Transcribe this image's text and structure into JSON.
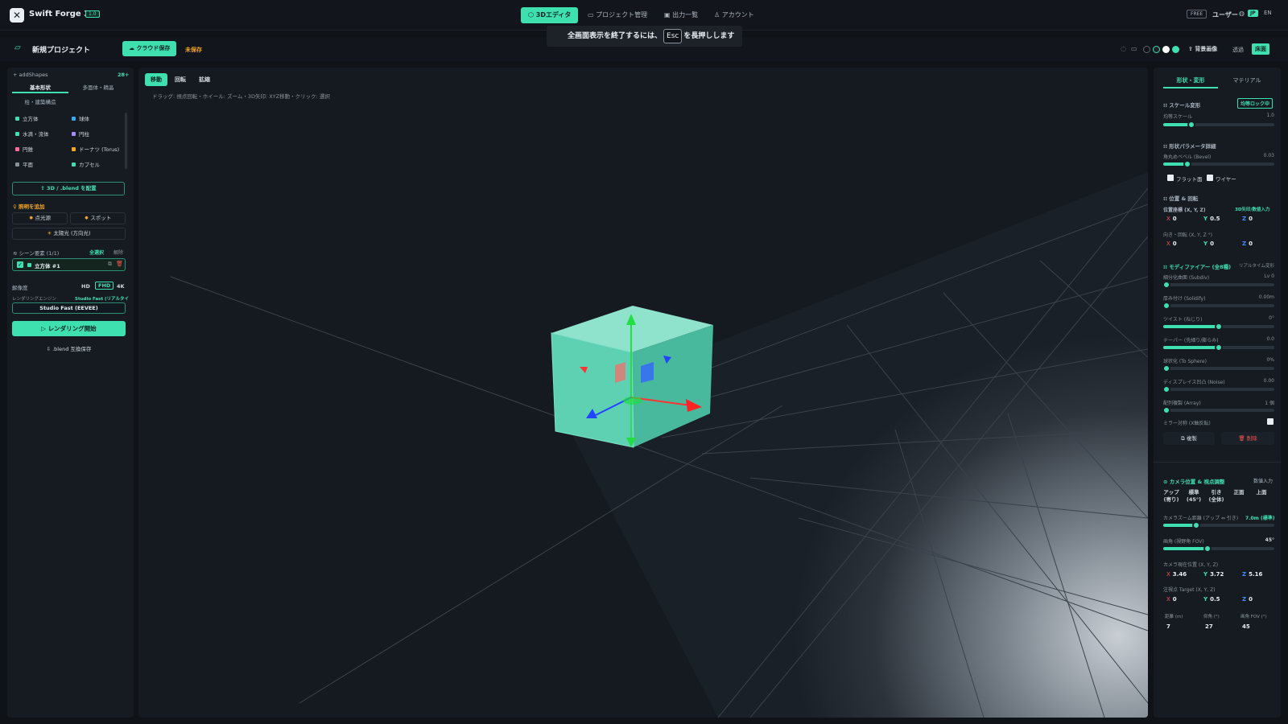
{
  "app": {
    "logo_icon": "app-logo-icon",
    "title": "Swift Forge 3D",
    "version": "1.0"
  },
  "nav": {
    "tabs": [
      {
        "label": "3Dエディタ",
        "icon": "cube-icon",
        "active": true
      },
      {
        "label": "プロジェクト管理",
        "icon": "folder-icon"
      },
      {
        "label": "出力一覧",
        "icon": "image-icon"
      },
      {
        "label": "アカウント",
        "icon": "user-icon"
      }
    ]
  },
  "top_right": {
    "plan": "FREE",
    "user": "ユーザー",
    "lang_jp": "JP",
    "lang_en": "EN"
  },
  "toast": {
    "prefix": "全画面表示を終了するには、",
    "key": "Esc",
    "suffix": "を長押しします"
  },
  "project": {
    "name": "新規プロジェクト",
    "cloud_save": "クラウド保存",
    "status": "未保存"
  },
  "toolbar": {
    "swatches": [
      "#0f1318",
      "#1c232b",
      "#ffffff",
      "#3ee0b0"
    ],
    "bg_image": "背景画像",
    "transparent": "透過",
    "floor": "床面"
  },
  "left": {
    "add_shapes": "addShapes",
    "count": "28+",
    "tabs": [
      "基本形状",
      "多面体・精晶",
      "柱・建築構造"
    ],
    "shapes": [
      {
        "label": "立方体",
        "color": "#3ee0b0"
      },
      {
        "label": "球体",
        "color": "#3aa8ff"
      },
      {
        "label": "水滴・流体",
        "color": "#3ee0b0"
      },
      {
        "label": "円柱",
        "color": "#a78bfa"
      },
      {
        "label": "円錐",
        "color": "#ff6b9a"
      },
      {
        "label": "ドーナツ (Torus)",
        "color": "#f5a623"
      },
      {
        "label": "平面",
        "color": "#8a939c"
      },
      {
        "label": "カプセル",
        "color": "#3ee0b0"
      }
    ],
    "place_blend": "3D / .blend を配置",
    "add_light": "照明を追加",
    "point_light": "点光源",
    "spot_light": "スポット",
    "sun_light": "太陽光 (方向光)",
    "scene_elements": "シーン要素 (1/1)",
    "select_all": "全選択",
    "deselect": "解除",
    "scene_item": "立方体 #1",
    "resolution_label": "解像度",
    "resolutions": [
      "HD",
      "FHD",
      "4K"
    ],
    "engine_label": "レンダリングエンジン",
    "engine_value": "Studio Fast (リアルタイム)",
    "engine_select": "Studio Fast (EEVEE)",
    "render_start": "レンダリング開始",
    "blend_save": ".blend 互換保存"
  },
  "viewport": {
    "modes": [
      "移動",
      "回転",
      "拡縮"
    ],
    "help": "ドラッグ: 視点回転・ホイール: ズーム・3D矢印: XYZ移動・クリック: 選択"
  },
  "right": {
    "tabs": [
      "形状・変形",
      "マテリアル"
    ],
    "scale_section": "スケール変形",
    "uniform_lock": "均等ロック中",
    "uniform_scale": {
      "label": "均等スケール",
      "value": "1.0",
      "fraction": 0.25
    },
    "shape_params": "形状パラメータ詳細",
    "bevel": {
      "label": "角丸めベベル (Bevel)",
      "value": "0.03",
      "fraction": 0.22
    },
    "flat_shading": "フラット面",
    "wireframe": "ワイヤー",
    "position_section": "位置 & 回転",
    "position_label": "位置座標 (X, Y, Z)",
    "direct_input": "3D矢印/数値入力",
    "position": {
      "x": "0",
      "y": "0.5",
      "z": "0"
    },
    "rotation_label": "向き・回転 (X, Y, Z °)",
    "rotation": {
      "x": "0",
      "y": "0",
      "z": "0"
    },
    "modifiers_section": "モディファイアー (全8種)",
    "realtime": "リアルタイム変形",
    "modifiers": [
      {
        "label": "細分化曲面 (Subdiv)",
        "value": "Lv 0",
        "fraction": 0.0
      },
      {
        "label": "厚み付け (Solidify)",
        "value": "0.00m",
        "fraction": 0.0
      },
      {
        "label": "ツイスト (ねじり)",
        "value": "0°",
        "fraction": 0.5
      },
      {
        "label": "テーパー (先細り/膨らみ)",
        "value": "0.0",
        "fraction": 0.5
      },
      {
        "label": "球状化 (To Sphere)",
        "value": "0%",
        "fraction": 0.0
      },
      {
        "label": "ディスプレイス凹凸 (Noise)",
        "value": "0.00",
        "fraction": 0.0
      },
      {
        "label": "配列複製 (Array)",
        "value": "1 個",
        "fraction": 0.0
      }
    ],
    "mirror": "ミラー対称 (X軸反転)",
    "duplicate": "複製",
    "delete": "削除",
    "camera_section": "カメラ位置 & 視点調整",
    "numeric_input": "数値入力",
    "camera_presets": [
      "アップ\n(寄り)",
      "標準\n(45°)",
      "引き\n(全体)",
      "正面",
      "上面"
    ],
    "zoom": {
      "label": "カメラズーム距離 (アップ ⇔ 引き)",
      "value": "7.0m (標準)",
      "fraction": 0.3
    },
    "fov": {
      "label": "画角 (視野角 FOV)",
      "value": "45°",
      "fraction": 0.4
    },
    "cam_pos_label": "カメラ現在位置 (X, Y, Z)",
    "cam_pos": {
      "x": "3.46",
      "y": "3.72",
      "z": "5.16"
    },
    "target_label": "注視点 Target (X, Y, Z)",
    "target": {
      "x": "0",
      "y": "0.5",
      "z": "0"
    },
    "stats_labels": [
      "距離 (m)",
      "仰角 (°)",
      "画角 FOV (°)"
    ],
    "stats_values": [
      "7",
      "27",
      "45"
    ]
  }
}
